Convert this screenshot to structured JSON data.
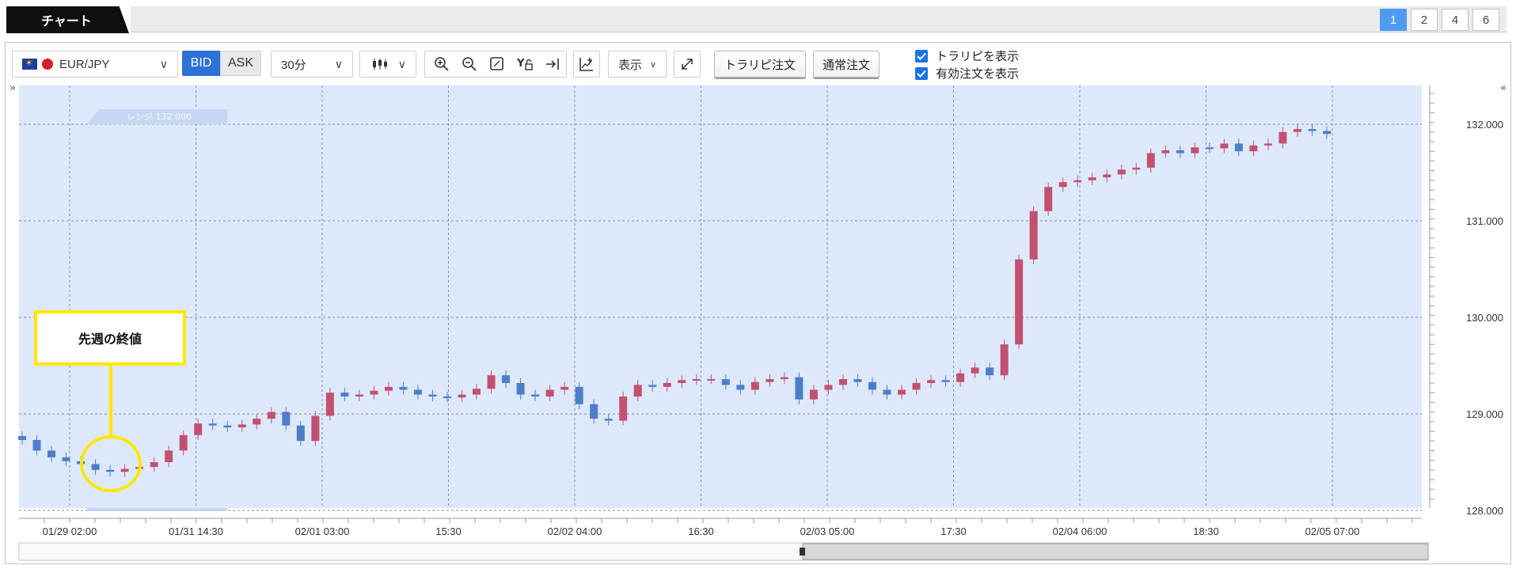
{
  "tabs": {
    "chart_tab": "チャート",
    "layouts": [
      "1",
      "2",
      "4",
      "6"
    ],
    "active_layout": "1"
  },
  "toolbar": {
    "symbol": "EUR/JPY",
    "bid": "BID",
    "ask": "ASK",
    "timeframe": "30分",
    "display": "表示",
    "trail_order": "トラリピ注文",
    "normal_order": "通常注文",
    "show_trail": "トラリピを表示",
    "show_active_orders": "有効注文を表示",
    "bid_active": true,
    "checkbox_checked": true
  },
  "colors": {
    "chart_bg": "#dde9fb",
    "up_candle": "#c2506f",
    "down_candle": "#4e7dc9",
    "annotation": "#ffe600",
    "accent_blue": "#2f72d6"
  },
  "chart_data": {
    "type": "candlestick",
    "instrument": "EUR/JPY",
    "interval": "30分",
    "y_ticks": [
      "132.000",
      "131.000",
      "130.000",
      "129.000",
      "128.000"
    ],
    "ylim": [
      128.0,
      132.0
    ],
    "x_ticks": [
      "01/29 02:00",
      "01/31 14:30",
      "02/01 03:00",
      "15:30",
      "02/02 04:00",
      "16:30",
      "02/03 05:00",
      "17:30",
      "02/04 06:00",
      "18:30",
      "02/05 07:00"
    ],
    "range_label": "レンジ 132.000",
    "annotation": "先週の終値",
    "grid": true,
    "series_close": [
      128.73,
      128.62,
      128.55,
      128.51,
      128.48,
      128.42,
      128.4,
      128.43,
      128.45,
      128.5,
      128.62,
      128.78,
      128.9,
      128.88,
      128.86,
      128.89,
      128.95,
      129.02,
      128.88,
      128.72,
      128.98,
      129.22,
      129.18,
      129.2,
      129.24,
      129.28,
      129.25,
      129.2,
      129.18,
      129.17,
      129.2,
      129.26,
      129.4,
      129.32,
      129.2,
      129.18,
      129.25,
      129.28,
      129.1,
      128.95,
      128.93,
      129.18,
      129.3,
      129.28,
      129.32,
      129.35,
      129.36,
      129.36,
      129.3,
      129.25,
      129.33,
      129.36,
      129.38,
      129.15,
      129.25,
      129.3,
      129.36,
      129.33,
      129.25,
      129.2,
      129.25,
      129.32,
      129.35,
      129.33,
      129.42,
      129.48,
      129.4,
      129.72,
      130.6,
      131.1,
      131.35,
      131.4,
      131.42,
      131.45,
      131.48,
      131.53,
      131.55,
      131.7,
      131.73,
      131.7,
      131.76,
      131.75,
      131.8,
      131.72,
      131.78,
      131.8,
      131.92,
      131.95,
      131.93,
      131.9
    ]
  }
}
